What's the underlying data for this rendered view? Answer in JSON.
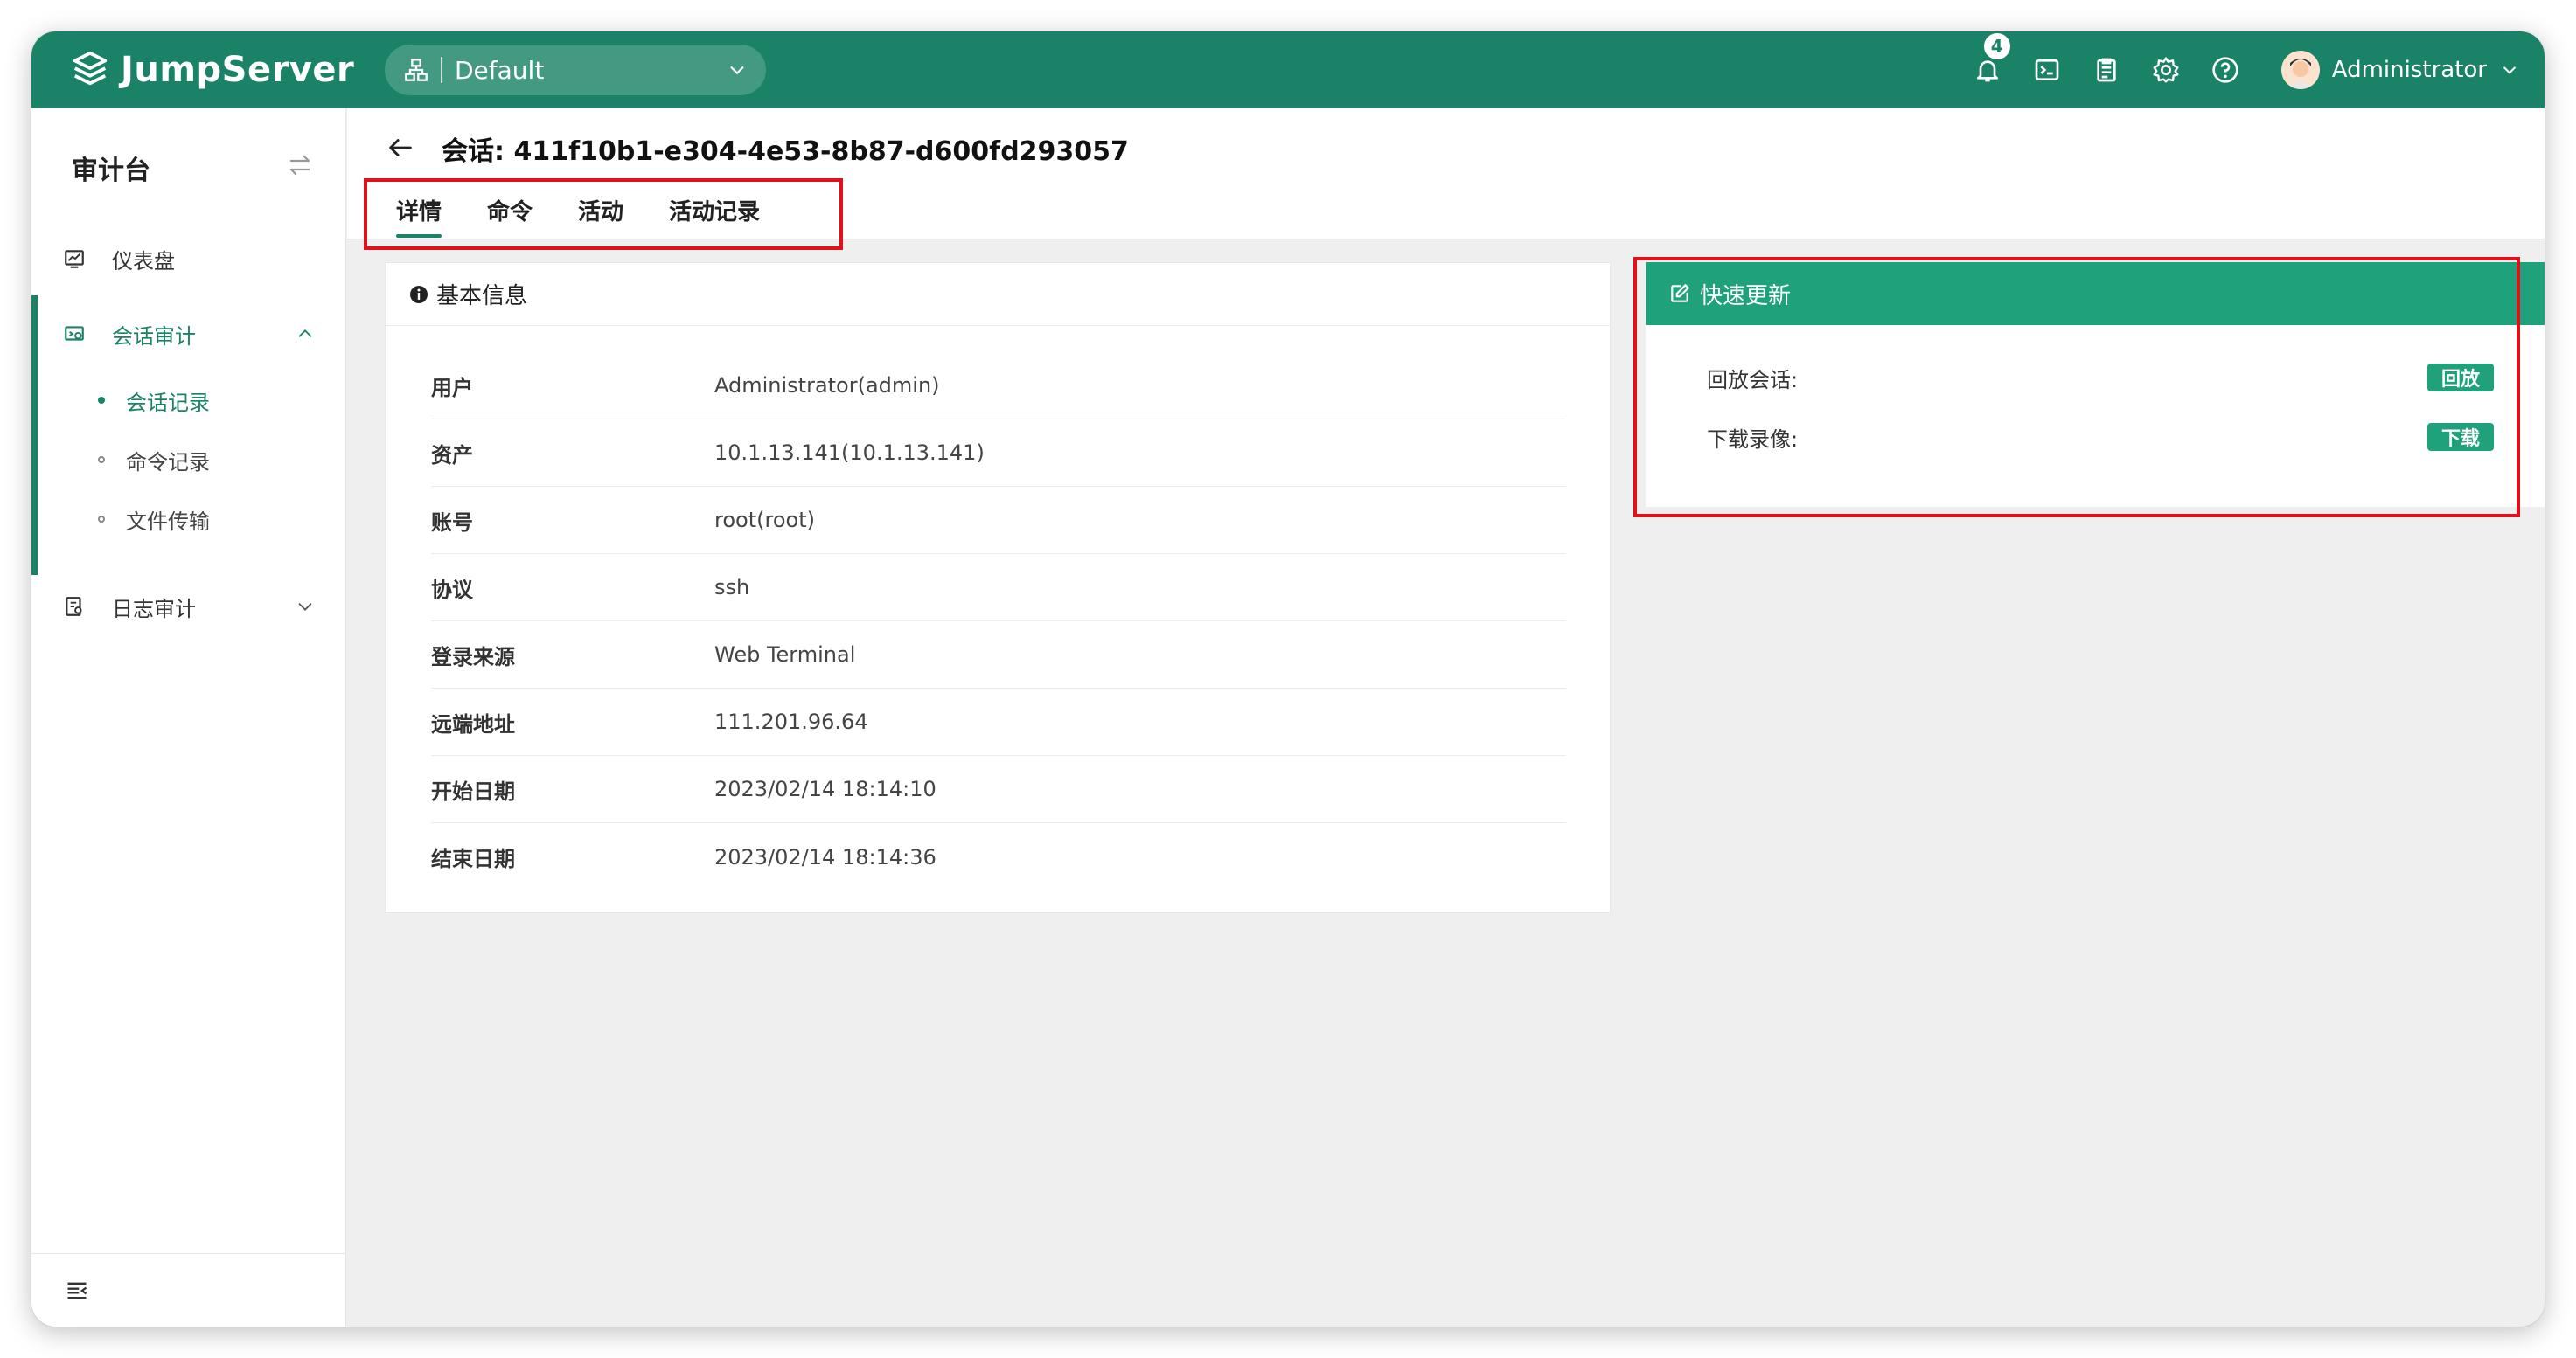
{
  "app": {
    "logo_text": "JumpServer",
    "org_selector": "Default"
  },
  "topbar": {
    "notification_count": "4",
    "username": "Administrator"
  },
  "sidebar": {
    "title": "审计台",
    "items": [
      {
        "label": "仪表盘"
      },
      {
        "label": "会话审计",
        "expanded": true,
        "children": [
          {
            "label": "会话记录",
            "active": true
          },
          {
            "label": "命令记录"
          },
          {
            "label": "文件传输"
          }
        ]
      },
      {
        "label": "日志审计",
        "expanded": false
      }
    ]
  },
  "page": {
    "title": "会话: 411f10b1-e304-4e53-8b87-d600fd293057",
    "tabs": [
      {
        "label": "详情",
        "active": true
      },
      {
        "label": "命令"
      },
      {
        "label": "活动"
      },
      {
        "label": "活动记录"
      }
    ]
  },
  "basic_info": {
    "heading": "基本信息",
    "rows": [
      {
        "key": "用户",
        "value": "Administrator(admin)"
      },
      {
        "key": "资产",
        "value": "10.1.13.141(10.1.13.141)"
      },
      {
        "key": "账号",
        "value": "root(root)"
      },
      {
        "key": "协议",
        "value": "ssh"
      },
      {
        "key": "登录来源",
        "value": "Web Terminal"
      },
      {
        "key": "远端地址",
        "value": "111.201.96.64"
      },
      {
        "key": "开始日期",
        "value": "2023/02/14 18:14:10"
      },
      {
        "key": "结束日期",
        "value": "2023/02/14 18:14:36"
      }
    ]
  },
  "quick_update": {
    "heading": "快速更新",
    "rows": [
      {
        "label": "回放会话:",
        "button": "回放"
      },
      {
        "label": "下载录像:",
        "button": "下载"
      }
    ]
  },
  "colors": {
    "brand": "#1a8367",
    "accent": "#1fa17c",
    "highlight": "#e2101a"
  },
  "icons": {
    "topbar": [
      "bell-icon",
      "terminal-icon",
      "clipboard-icon",
      "settings-icon",
      "help-icon"
    ],
    "sidebar": [
      "dashboard-icon",
      "session-audit-icon",
      "log-audit-icon",
      "menu-collapse-icon"
    ]
  }
}
